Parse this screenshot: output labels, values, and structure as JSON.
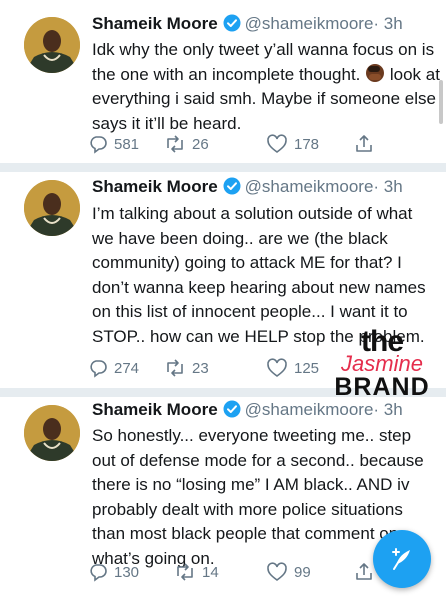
{
  "tweets": [
    {
      "name": "Shameik Moore",
      "handle": "@shameikmoore",
      "time": "· 3h",
      "text_before_emoji": "Idk why the only tweet y’all wanna focus on is the one with an incomplete thought.",
      "emoji": "man-facepalming",
      "text_after_emoji": " look at everything i said smh. Maybe if someone else says it it’ll be heard.",
      "replies": "581",
      "retweets": "26",
      "likes": "178"
    },
    {
      "name": "Shameik Moore",
      "handle": "@shameikmoore",
      "time": "· 3h",
      "text": "I’m talking about a solution outside of what we have been doing.. are we (the black community) going to attack ME for that? I don’t wanna keep hearing about new names on this list of innocent people... I want it to STOP.. how can we HELP stop the problem.",
      "replies": "274",
      "retweets": "23",
      "likes": "125"
    },
    {
      "name": "Shameik Moore",
      "handle": "@shameikmoore",
      "time": "· 3h",
      "text": "So honestly... everyone tweeting me.. step out of defense mode for a second.. because there is no “losing me” I AM black.. AND iv probably dealt with more police situations than most black people that comment on what’s going on.",
      "replies": "130",
      "retweets": "14",
      "likes": "99"
    }
  ],
  "watermark": {
    "line1": "the",
    "line2": "Jasmine",
    "line3": "BRAND"
  },
  "icons": {
    "verified": "verified-badge-icon",
    "reply": "reply-icon",
    "retweet": "retweet-icon",
    "like": "heart-icon",
    "share": "share-icon",
    "compose": "compose-tweet-icon"
  },
  "colors": {
    "accent": "#1da1f2",
    "muted": "#657786",
    "separator": "#e6ecf0",
    "watermark_red": "#e52e4d"
  }
}
